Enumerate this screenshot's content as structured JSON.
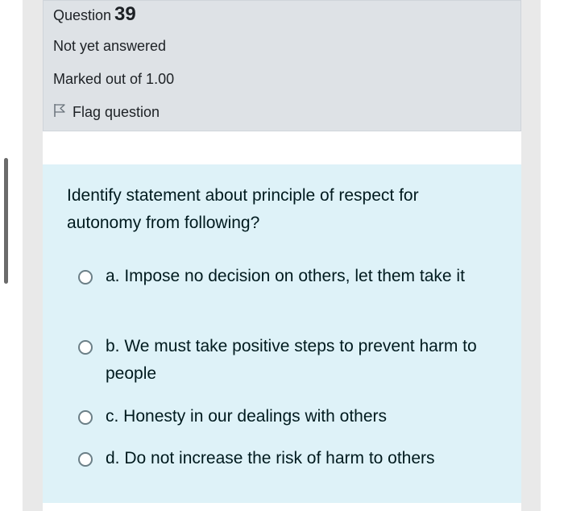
{
  "question": {
    "label": "Question",
    "number": "39",
    "state": "Not yet answered",
    "grade": "Marked out of 1.00",
    "flag_label": "Flag question"
  },
  "question_text": "Identify statement about principle of respect for autonomy from following?",
  "answers": [
    {
      "text": "a. Impose no decision on others, let them take it"
    },
    {
      "text": "b. We must take positive steps to prevent harm to people"
    },
    {
      "text": "c. Honesty in our dealings with others"
    },
    {
      "text": "d. Do not increase the risk of harm to others"
    }
  ],
  "colors": {
    "info_bg": "#dee2e6",
    "formulation_bg": "#def2f8",
    "text": "#001a1e"
  }
}
